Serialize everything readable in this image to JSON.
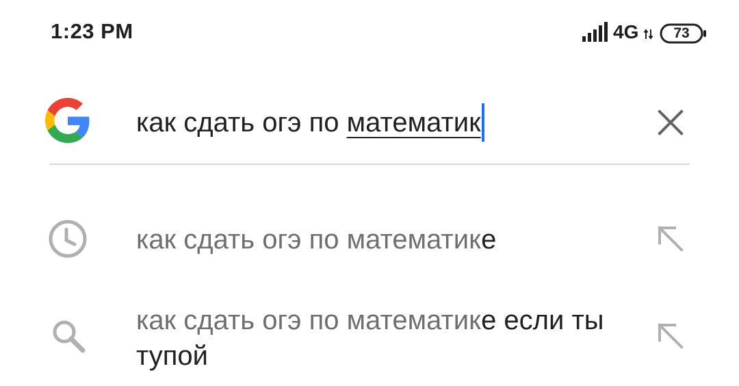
{
  "status_bar": {
    "time": "1:23 PM",
    "network": "4G",
    "battery": "73"
  },
  "search": {
    "logo_icon": "google-g-icon",
    "query_prefix": "как сдать огэ по ",
    "query_typed_word": "математик",
    "clear_icon": "close-icon"
  },
  "suggestions": [
    {
      "icon": "history-clock-icon",
      "matched": "как сдать огэ по математик",
      "completion": "е",
      "action_icon": "fill-query-arrow-icon"
    },
    {
      "icon": "search-icon",
      "matched": "как сдать огэ по математик",
      "completion": "е если ты тупой",
      "action_icon": "fill-query-arrow-icon"
    }
  ],
  "colors": {
    "cursor": "#1a73e8",
    "matched_text": "#6f6f6f",
    "completion_text": "#202124",
    "icon_gray": "#b0b0b0",
    "google_blue": "#4285F4",
    "google_red": "#EA4335",
    "google_yellow": "#FBBC05",
    "google_green": "#34A853"
  }
}
